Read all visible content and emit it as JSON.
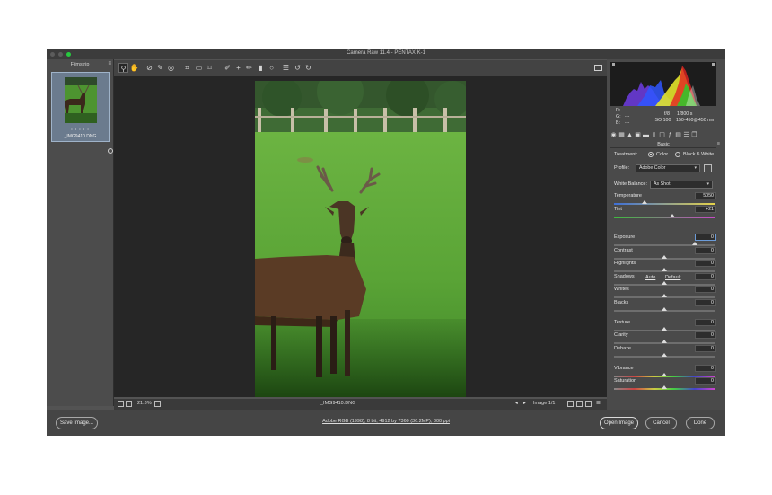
{
  "window": {
    "title": "Camera Raw 11.4  -  PENTAX K-1",
    "traffic_colors": [
      "#5c5c5c",
      "#5c5c5c",
      "#27c93f"
    ]
  },
  "toolbar": {
    "tools": [
      {
        "icon": "zoom-icon",
        "glyph": "⚲",
        "selected": true
      },
      {
        "icon": "hand-icon",
        "glyph": "✋"
      },
      {
        "icon": "white-balance-icon",
        "glyph": "⊘"
      },
      {
        "icon": "color-sampler-icon",
        "glyph": "✎"
      },
      {
        "icon": "target-adjust-icon",
        "glyph": "◎"
      },
      {
        "icon": "crop-icon",
        "glyph": "⌗"
      },
      {
        "icon": "straighten-icon",
        "glyph": "▭"
      },
      {
        "icon": "transform-icon",
        "glyph": "⌑"
      },
      {
        "icon": "spot-removal-icon",
        "glyph": "✐"
      },
      {
        "icon": "red-eye-icon",
        "glyph": "+"
      },
      {
        "icon": "adjustment-brush-icon",
        "glyph": "✏"
      },
      {
        "icon": "graduated-filter-icon",
        "glyph": "▮"
      },
      {
        "icon": "radial-filter-icon",
        "glyph": "○"
      },
      {
        "icon": "preferences-icon",
        "glyph": "☰"
      },
      {
        "icon": "rotate-left-icon",
        "glyph": "↺"
      },
      {
        "icon": "rotate-right-icon",
        "glyph": "↻"
      }
    ]
  },
  "filmstrip": {
    "header": "Filmstrip",
    "menu": "≡",
    "thumbnail": {
      "stars": "• • • • •",
      "filename": "_IMG9410.DNG"
    }
  },
  "canvas": {
    "zoom": "21.3%",
    "filename": "_IMG9410.DNG",
    "image_counter": "Image 1/1"
  },
  "footer": {
    "save_label": "Save Image...",
    "workflow_info": "Adobe RGB (1998); 8 bit; 4912 by 7360 (36.2MP); 300 ppi",
    "open_label": "Open Image",
    "cancel_label": "Cancel",
    "done_label": "Done"
  },
  "readout": {
    "r_label": "R:",
    "r_value": "---",
    "g_label": "G:",
    "g_value": "---",
    "b_label": "B:",
    "b_value": "---",
    "aperture": "f/8",
    "shutter": "1/800 s",
    "iso": "ISO 100",
    "lens": "150-450@450 mm"
  },
  "basic": {
    "section_title": "Basic",
    "menu": "≡",
    "treatment_label": "Treatment:",
    "treatment_color": "Color",
    "treatment_bw": "Black & White",
    "profile_label": "Profile:",
    "profile_value": "Adobe Color",
    "wb_label": "White Balance:",
    "wb_value": "As Shot",
    "auto_label": "Auto",
    "default_label": "Default",
    "sliders": [
      {
        "id": "temperature",
        "label": "Temperature",
        "value": "5050",
        "position": 0.3
      },
      {
        "id": "tint",
        "label": "Tint",
        "value": "+21",
        "position": 0.58
      },
      {
        "id": "exposure",
        "label": "Exposure",
        "value": "0",
        "position": 0.8
      },
      {
        "id": "contrast",
        "label": "Contrast",
        "value": "0",
        "position": 0.5
      },
      {
        "id": "highlights",
        "label": "Highlights",
        "value": "0",
        "position": 0.5
      },
      {
        "id": "shadows",
        "label": "Shadows",
        "value": "0",
        "position": 0.5
      },
      {
        "id": "whites",
        "label": "Whites",
        "value": "0",
        "position": 0.5
      },
      {
        "id": "blacks",
        "label": "Blacks",
        "value": "0",
        "position": 0.5
      },
      {
        "id": "texture",
        "label": "Texture",
        "value": "0",
        "position": 0.5
      },
      {
        "id": "clarity",
        "label": "Clarity",
        "value": "0",
        "position": 0.5
      },
      {
        "id": "dehaze",
        "label": "Dehaze",
        "value": "0",
        "position": 0.5
      },
      {
        "id": "vibrance",
        "label": "Vibrance",
        "value": "0",
        "position": 0.5
      },
      {
        "id": "saturation",
        "label": "Saturation",
        "value": "0",
        "position": 0.5
      }
    ]
  }
}
